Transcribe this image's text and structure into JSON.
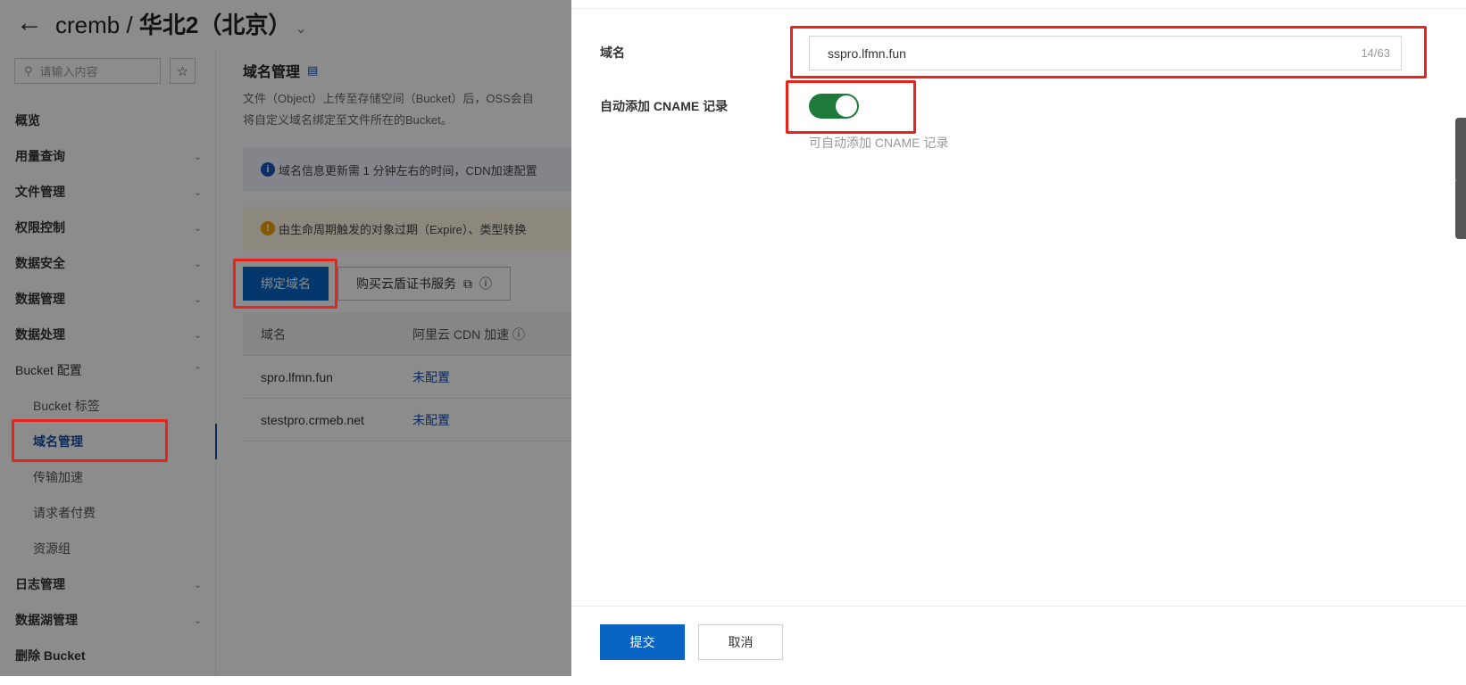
{
  "header": {
    "back_icon": "arrow-left-icon",
    "title_prefix": "cremb / ",
    "title_region": "华北2（北京）",
    "chevron_icon": "chevron-down-icon"
  },
  "sidebar": {
    "search_placeholder": "请输入内容",
    "search_icon": "search-icon",
    "star_icon": "star-icon",
    "items": [
      {
        "label": "概览"
      },
      {
        "label": "用量查询"
      },
      {
        "label": "文件管理"
      },
      {
        "label": "权限控制"
      },
      {
        "label": "数据安全"
      },
      {
        "label": "数据管理"
      },
      {
        "label": "数据处理"
      },
      {
        "label": "Bucket 配置"
      }
    ],
    "sub_items": [
      {
        "label": "Bucket 标签"
      },
      {
        "label": "域名管理"
      },
      {
        "label": "传输加速"
      },
      {
        "label": "请求者付费"
      },
      {
        "label": "资源组"
      }
    ],
    "tail_items": [
      {
        "label": "日志管理"
      },
      {
        "label": "数据湖管理"
      },
      {
        "label": "删除 Bucket"
      }
    ]
  },
  "content": {
    "title": "域名管理",
    "description_line1": "文件（Object）上传至存储空间（Bucket）后，OSS会自",
    "description_line2": "将自定义域名绑定至文件所在的Bucket。",
    "info_notice": "域名信息更新需 1 分钟左右的时间，CDN加速配置",
    "warn_notice": "由生命周期触发的对象过期（Expire）、类型转换",
    "bind_button": "绑定域名",
    "buy_button": "购买云盾证书服务",
    "table": {
      "headers": [
        "域名",
        "阿里云 CDN 加速"
      ],
      "rows": [
        [
          "spro.lfmn.fun",
          "未配置"
        ],
        [
          "stestpro.crmeb.net",
          "未配置"
        ]
      ]
    }
  },
  "drawer": {
    "domain_label": "域名",
    "domain_value": "sspro.lfmn.fun",
    "domain_counter": "14/63",
    "cname_label": "自动添加 CNAME 记录",
    "cname_enabled": true,
    "cname_hint": "可自动添加 CNAME 记录",
    "submit_button": "提交",
    "cancel_button": "取消"
  },
  "colors": {
    "primary": "#0964c4",
    "toggle_on": "#1e7a3b",
    "highlight": "#e8231c",
    "link": "#1a4fa0"
  }
}
